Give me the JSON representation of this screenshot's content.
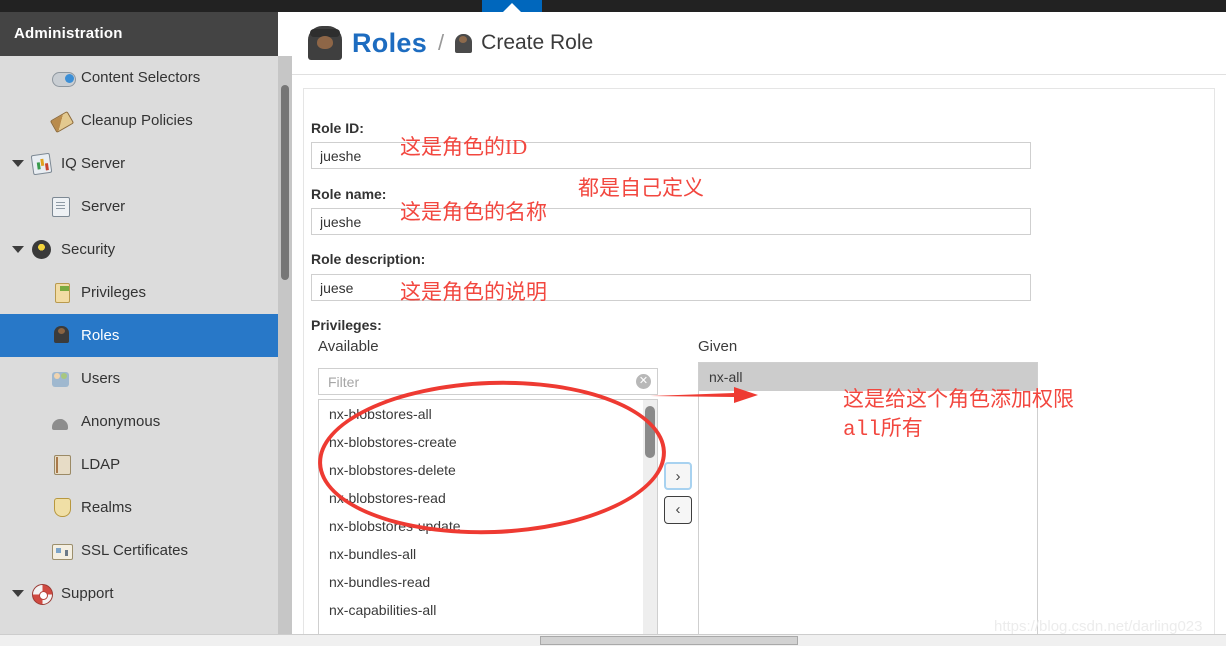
{
  "window": {
    "tab_indicator_color": "#0067bd",
    "top_strip_color": "#222222"
  },
  "sidebar": {
    "title": "Administration",
    "background": "#dcdcdc",
    "selected_color": "#2878c8",
    "items": [
      {
        "label": "Content Selectors",
        "icon": "content-selectors-icon",
        "level": 2,
        "selected": false,
        "expandable": false
      },
      {
        "label": "Cleanup Policies",
        "icon": "broom-icon",
        "level": 2,
        "selected": false,
        "expandable": false
      },
      {
        "label": "IQ Server",
        "icon": "iq-server-icon",
        "level": 1,
        "selected": false,
        "expandable": true
      },
      {
        "label": "Server",
        "icon": "server-icon",
        "level": 2,
        "selected": false,
        "expandable": false
      },
      {
        "label": "Security",
        "icon": "security-icon",
        "level": 1,
        "selected": false,
        "expandable": true
      },
      {
        "label": "Privileges",
        "icon": "privileges-icon",
        "level": 2,
        "selected": false,
        "expandable": false
      },
      {
        "label": "Roles",
        "icon": "roles-icon",
        "level": 2,
        "selected": true,
        "expandable": false
      },
      {
        "label": "Users",
        "icon": "users-icon",
        "level": 2,
        "selected": false,
        "expandable": false
      },
      {
        "label": "Anonymous",
        "icon": "anonymous-icon",
        "level": 2,
        "selected": false,
        "expandable": false
      },
      {
        "label": "LDAP",
        "icon": "ldap-icon",
        "level": 2,
        "selected": false,
        "expandable": false
      },
      {
        "label": "Realms",
        "icon": "realms-icon",
        "level": 2,
        "selected": false,
        "expandable": false
      },
      {
        "label": "SSL Certificates",
        "icon": "ssl-certificates-icon",
        "level": 2,
        "selected": false,
        "expandable": false
      },
      {
        "label": "Support",
        "icon": "support-icon",
        "level": 1,
        "selected": false,
        "expandable": true
      }
    ]
  },
  "breadcrumb": {
    "root": "Roles",
    "separator": "/",
    "current": "Create Role",
    "root_color": "#1d6cc0"
  },
  "form": {
    "role_id": {
      "label": "Role ID:",
      "value": "jueshe"
    },
    "role_name": {
      "label": "Role name:",
      "value": "jueshe"
    },
    "role_description": {
      "label": "Role description:",
      "value": "juese"
    },
    "privileges_label": "Privileges:"
  },
  "transfer": {
    "available_title": "Available",
    "given_title": "Given",
    "filter_placeholder": "Filter",
    "filter_value": "",
    "clear_icon_glyph": "✕",
    "move_right_label": "›",
    "move_left_label": "‹",
    "available_items": [
      "nx-blobstores-all",
      "nx-blobstores-create",
      "nx-blobstores-delete",
      "nx-blobstores-read",
      "nx-blobstores-update",
      "nx-bundles-all",
      "nx-bundles-read",
      "nx-capabilities-all"
    ],
    "given_items": [
      {
        "label": "nx-all",
        "selected": true
      }
    ]
  },
  "annotations": {
    "color": "#f2473f",
    "role_id_note": "这是角色的ID",
    "role_name_note": "这是角色的名称",
    "self_defined_note": "都是自己定义",
    "role_desc_note": "这是角色的说明",
    "given_note_line1": "这是给这个角色添加权限",
    "given_note_line2": "all所有"
  },
  "watermark": "https://blog.csdn.net/darling023"
}
